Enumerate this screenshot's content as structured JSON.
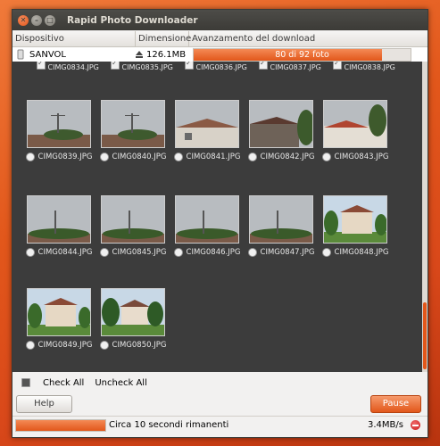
{
  "window": {
    "title": "Rapid Photo Downloader"
  },
  "devices": {
    "columns": [
      "Dispositivo",
      "Dimensione",
      "Avanzamento del download"
    ],
    "rows": [
      {
        "name": "SANVOL",
        "size": "126.1MB",
        "progress_text": "80 di 92 foto",
        "progress": 0.87
      }
    ]
  },
  "gallery": {
    "top_row": [
      "CIMG0834.JPG",
      "CIMG0835.JPG",
      "CIMG0836.JPG",
      "CIMG0837.JPG",
      "CIMG0838.JPG"
    ],
    "items": [
      {
        "file": "CIMG0839.JPG",
        "scene": "roof"
      },
      {
        "file": "CIMG0840.JPG",
        "scene": "roof"
      },
      {
        "file": "CIMG0841.JPG",
        "scene": "house"
      },
      {
        "file": "CIMG0842.JPG",
        "scene": "house-dark"
      },
      {
        "file": "CIMG0843.JPG",
        "scene": "house-red"
      },
      {
        "file": "CIMG0844.JPG",
        "scene": "trees"
      },
      {
        "file": "CIMG0845.JPG",
        "scene": "trees"
      },
      {
        "file": "CIMG0846.JPG",
        "scene": "trees"
      },
      {
        "file": "CIMG0847.JPG",
        "scene": "trees"
      },
      {
        "file": "CIMG0848.JPG",
        "scene": "villa"
      },
      {
        "file": "CIMG0849.JPG",
        "scene": "villa"
      },
      {
        "file": "CIMG0850.JPG",
        "scene": "villa-2"
      }
    ]
  },
  "checkbar": {
    "check_all": "Check All",
    "uncheck_all": "Uncheck All"
  },
  "buttons": {
    "help": "Help",
    "pause": "Pause"
  },
  "status": {
    "text": "Circa 10 secondi rimanenti",
    "speed": "3.4MB/s",
    "progress": 1.0
  },
  "colors": {
    "accent": "#e2571b"
  },
  "icons": [
    "close-icon",
    "minimize-icon",
    "maximize-icon",
    "device-icon",
    "eject-icon",
    "checkbox-icon",
    "stop-icon"
  ]
}
